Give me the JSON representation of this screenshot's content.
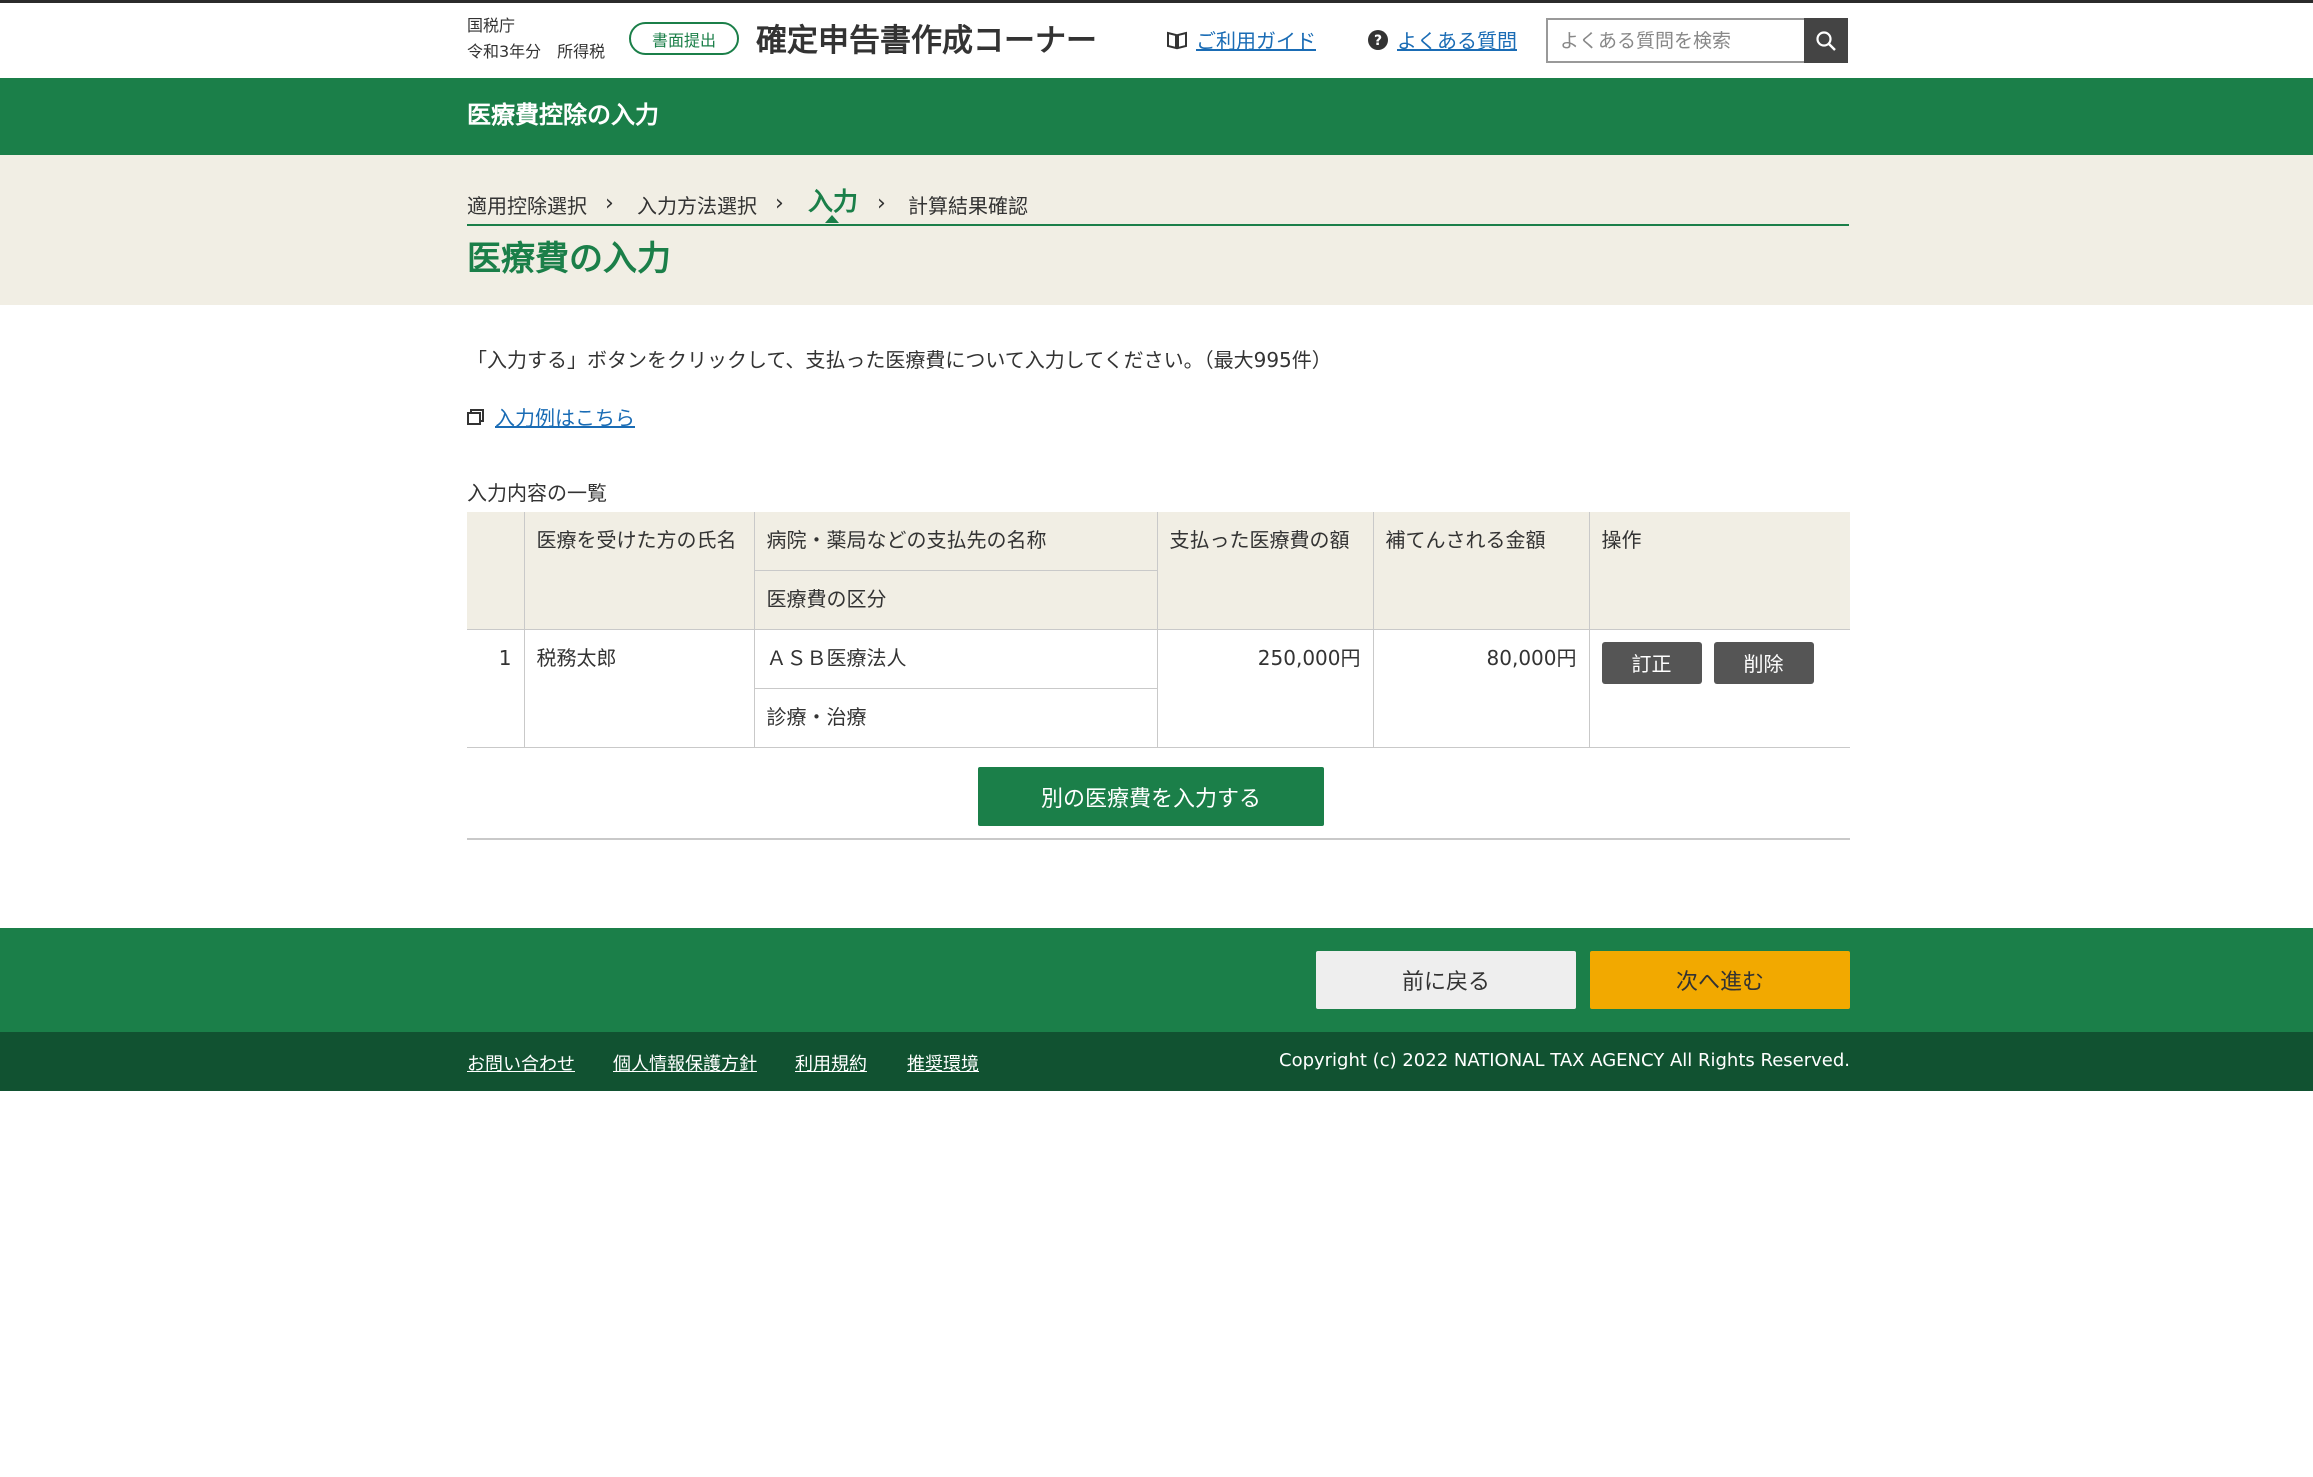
{
  "header": {
    "agency": "国税庁",
    "year_tax": "令和3年分　所得税",
    "badge": "書面提出",
    "app_title": "確定申告書作成コーナー",
    "guide_link": "ご利用ガイド",
    "faq_link": "よくある質問",
    "search_placeholder": "よくある質問を検索"
  },
  "section_title": "医療費控除の入力",
  "steps": [
    "適用控除選択",
    "入力方法選択",
    "入力",
    "計算結果確認"
  ],
  "active_step": 2,
  "page_title": "医療費の入力",
  "instruction": "「入力する」ボタンをクリックして、支払った医療費について入力してください。（最大995件）",
  "example_link": "入力例はこちら",
  "list_label": "入力内容の一覧",
  "table": {
    "headers": {
      "name": "医療を受けた方の氏名",
      "payee": "病院・薬局などの支払先の名称",
      "category": "医療費の区分",
      "paid": "支払った医療費の額",
      "reimbursed": "補てんされる金額",
      "action": "操作"
    },
    "rows": [
      {
        "no": "1",
        "name": "税務太郎",
        "payee": "ＡＳＢ医療法人",
        "category": "診療・治療",
        "paid": "250,000円",
        "reimbursed": "80,000円",
        "edit": "訂正",
        "delete": "削除"
      }
    ]
  },
  "add_button": "別の医療費を入力する",
  "nav": {
    "back": "前に戻る",
    "next": "次へ進む"
  },
  "footer": {
    "links": [
      "お問い合わせ",
      "個人情報保護方針",
      "利用規約",
      "推奨環境"
    ],
    "copyright": "Copyright (c) 2022 NATIONAL TAX AGENCY All Rights Reserved."
  },
  "colors": {
    "brand_green": "#1b7f49",
    "dark_green": "#115231",
    "beige": "#f1eee4",
    "next_yellow": "#f2a900",
    "link_blue": "#1a6cb5"
  }
}
